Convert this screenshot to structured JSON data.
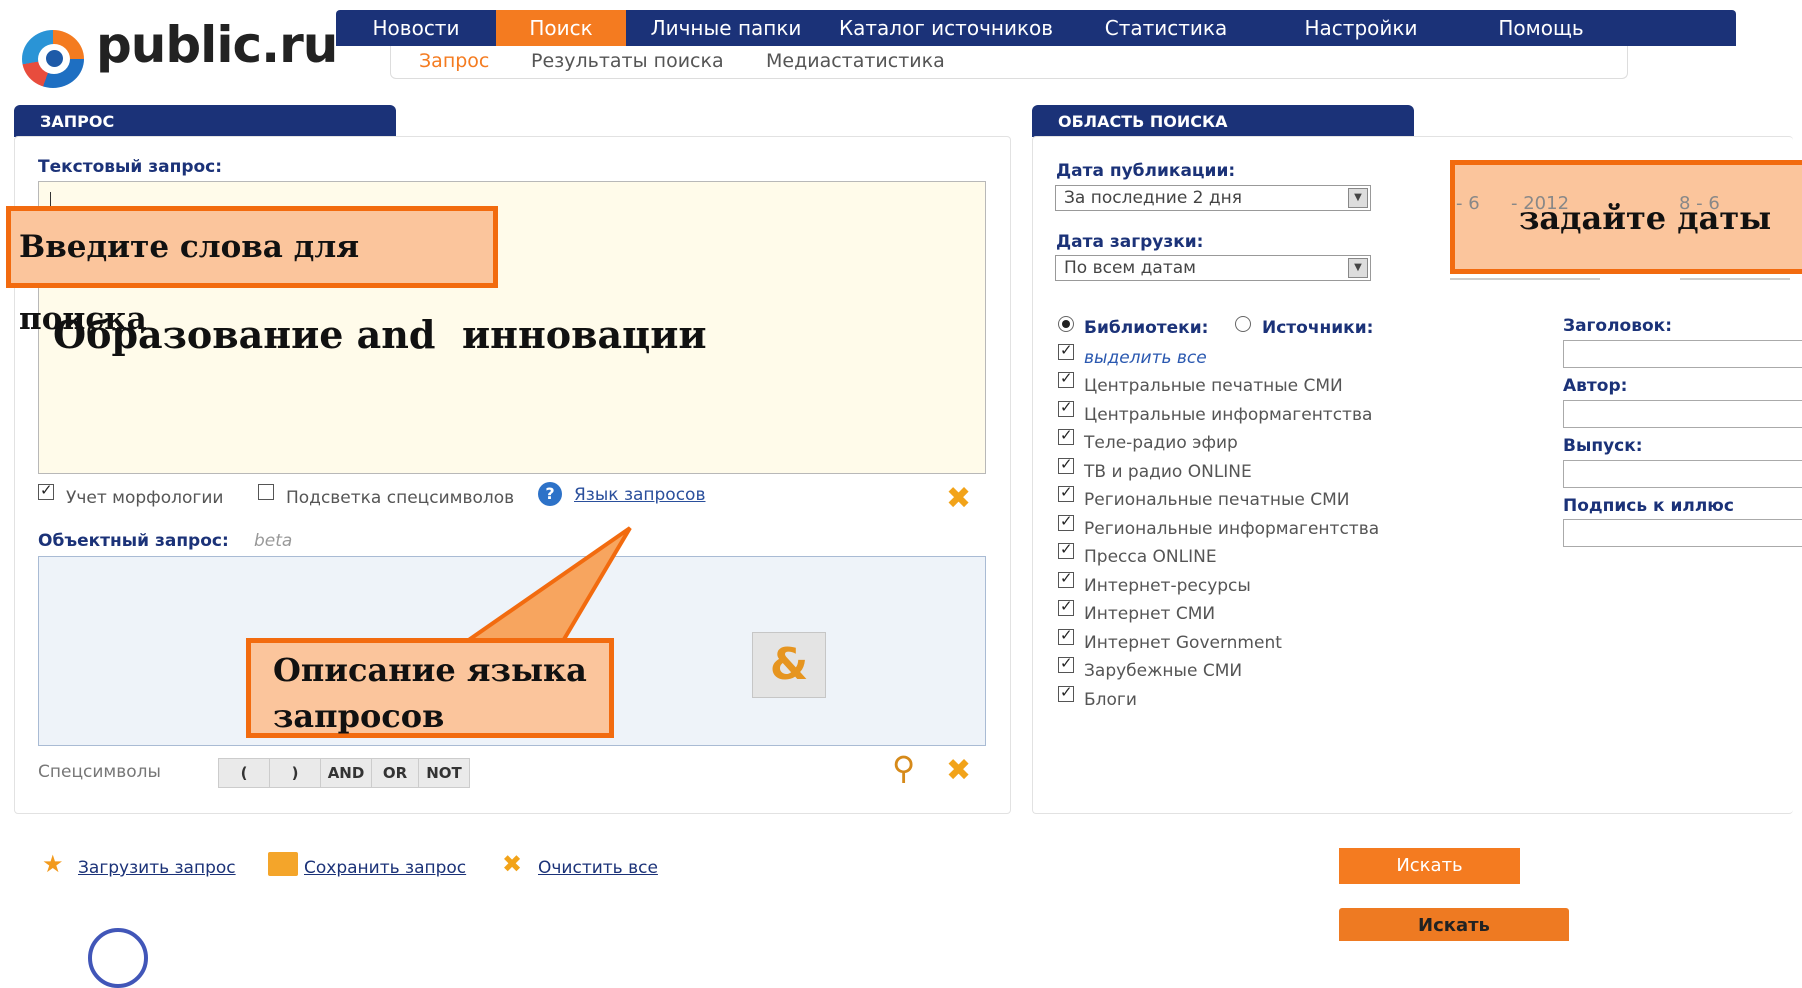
{
  "brand": {
    "name": "public.ru"
  },
  "topnav": [
    {
      "label": "Новости"
    },
    {
      "label": "Поиск",
      "active": true
    },
    {
      "label": "Личные папки"
    },
    {
      "label": "Каталог источников"
    },
    {
      "label": "Статистика"
    },
    {
      "label": "Настройки"
    },
    {
      "label": "Помощь"
    }
  ],
  "subnav": [
    {
      "label": "Запрос",
      "active": true
    },
    {
      "label": "Результаты поиска"
    },
    {
      "label": "Медиастатистика"
    }
  ],
  "query_panel": {
    "title": "ЗАПРОС",
    "text_query_label": "Текстовый запрос:",
    "text_query_value": "Образование and  инновации",
    "morphology_label": "Учет морфологии",
    "morphology_checked": true,
    "highlight_label": "Подсветка спецсимволов",
    "highlight_checked": false,
    "query_language_link": "Язык запросов",
    "object_query_label": "Объектный запрос:",
    "object_query_beta": "beta",
    "special_symbols_label": "Спецсимволы",
    "special_symbols": [
      "(",
      ")",
      "AND",
      "OR",
      "NOT"
    ],
    "ampersand": "&"
  },
  "scope_panel": {
    "title": "ОБЛАСТЬ ПОИСКА",
    "pub_date_label": "Дата публикации:",
    "pub_date_value": "За последние 2 дня",
    "load_date_label": "Дата загрузки:",
    "load_date_value": "По всем датам",
    "date_from_fragment": "- 6",
    "date_year_fragment": "- 2012",
    "date_right_fragment": "8 - 6",
    "libraries_label": "Библиотеки:",
    "sources_label": "Источники:",
    "select_all": "выделить все",
    "libraries": [
      "Центральные печатные СМИ",
      "Центральные информагентства",
      "Теле-радио эфир",
      "ТВ и радио ONLINE",
      "Региональные печатные СМИ",
      "Региональные информагентства",
      "Пресса ONLINE",
      "Интернет-ресурсы",
      "Интернет СМИ",
      "Интернет Government",
      "Зарубежные СМИ",
      "Блоги"
    ],
    "title_field_label": "Заголовок:",
    "author_field_label": "Автор:",
    "issue_field_label": "Выпуск:",
    "caption_field_label": "Подпись к иллюс"
  },
  "bottom_actions": {
    "load_query": "Загрузить запрос",
    "save_query": "Сохранить запрос",
    "clear_all": "Очистить все",
    "search_button_1": "Искать",
    "search_button_2": "Искать"
  },
  "callouts": {
    "enter_words": "Введите слова для поиска",
    "query_language_desc_1": "Описание языка",
    "query_language_desc_2": "запросов",
    "set_dates": "задайте даты"
  },
  "colors": {
    "navy": "#1b3278",
    "orange": "#f47b20",
    "query_bg": "#fffbea",
    "callout_fill": "#fbc59c",
    "callout_border": "#f26b0f"
  }
}
